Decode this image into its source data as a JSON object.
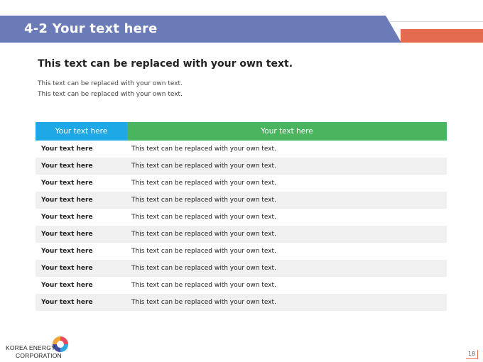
{
  "header": {
    "title": "4-2 Your text here",
    "colors": {
      "title_bar": "#6b7bb8",
      "accent_bar": "#e46b50"
    }
  },
  "content": {
    "subtitle": "This text can be replaced with your own text.",
    "description_lines": [
      "This text can be replaced with your own text.",
      "This text can be replaced with your own text."
    ]
  },
  "table": {
    "headers": [
      "Your text here",
      "Your text here"
    ],
    "header_colors": [
      "#1ea8e6",
      "#4ab45e"
    ],
    "rows": [
      [
        "Your text here",
        "This text can be replaced with your own text."
      ],
      [
        "Your text here",
        "This text can be replaced with your own text."
      ],
      [
        "Your text here",
        "This text can be replaced with your own text."
      ],
      [
        "Your text here",
        "This text can be replaced with your own text."
      ],
      [
        "Your text here",
        "This text can be replaced with your own text."
      ],
      [
        "Your text here",
        "This text can be replaced with your own text."
      ],
      [
        "Your text here",
        "This text can be replaced with your own text."
      ],
      [
        "Your text here",
        "This text can be replaced with your own text."
      ],
      [
        "Your text here",
        "This text can be replaced with your own text."
      ],
      [
        "Your text here",
        "This text can be replaced with your own text."
      ]
    ]
  },
  "footer": {
    "logo_line1": "KOREA ENERGY",
    "logo_line2": "CORPORATION",
    "logo_icon": "swirl-logo-icon",
    "page_number": "18"
  }
}
